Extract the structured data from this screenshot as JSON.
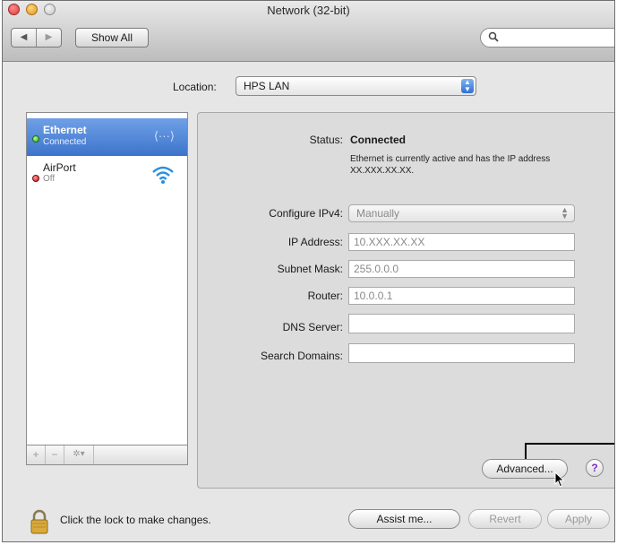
{
  "window": {
    "title": "Network (32-bit)"
  },
  "toolbar": {
    "back_glyph": "◀",
    "forward_glyph": "▶",
    "show_all_label": "Show All",
    "search_placeholder": "",
    "search_icon": "magnifier-icon"
  },
  "location": {
    "label": "Location:",
    "value": "HPS LAN"
  },
  "services": [
    {
      "name": "Ethernet",
      "status": "Connected",
      "state": "green",
      "icon": "ethernet-icon",
      "icon_glyph": "⟨···⟩"
    },
    {
      "name": "AirPort",
      "status": "Off",
      "state": "red",
      "icon": "wifi-icon"
    }
  ],
  "services_footer": {
    "add": "+",
    "remove": "−",
    "gear": "✲▾"
  },
  "detail": {
    "status_label": "Status:",
    "status_value": "Connected",
    "status_description": "Ethernet is currently active and has the IP address XX.XXX.XX.XX.",
    "configure_label": "Configure IPv4:",
    "configure_value": "Manually",
    "ip_label": "IP Address:",
    "ip_value": "10.XXX.XX.XX",
    "subnet_label": "Subnet Mask:",
    "subnet_value": "255.0.0.0",
    "router_label": "Router:",
    "router_value": "10.0.0.1",
    "dns_label": "DNS Server:",
    "dns_value": "",
    "search_domains_label": "Search Domains:",
    "search_domains_value": "",
    "advanced_label": "Advanced...",
    "help_label": "?"
  },
  "bottom": {
    "lock_text": "Click the lock to make changes.",
    "assist_label": "Assist me...",
    "revert_label": "Revert",
    "apply_label": "Apply"
  },
  "colors": {
    "selection": "#3d74cc",
    "status_green": "#2fa519",
    "status_red": "#c0161a"
  }
}
